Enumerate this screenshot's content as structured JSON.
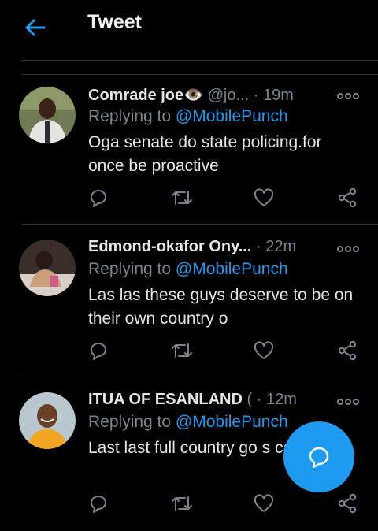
{
  "header": {
    "title": "Tweet",
    "back_icon": "arrow-left-icon"
  },
  "tweets": [
    {
      "name": "Comrade joe👁️",
      "handle": "@jo...",
      "dot": "·",
      "time": "19m",
      "replying_prefix": "Replying to",
      "replying_to": "@MobilePunch",
      "text": "Oga senate do state policing.for once be proactive"
    },
    {
      "name": "Edmond-okafor Ony...",
      "handle": "",
      "dot": "·",
      "time": "22m",
      "replying_prefix": "Replying to",
      "replying_to": "@MobilePunch",
      "text": "Las las these guys deserve to be on their own country o"
    },
    {
      "name": "ITUA OF ESANLAND",
      "handle": "(",
      "dot": "·",
      "time": "12m",
      "replying_prefix": "Replying to",
      "replying_to": "@MobilePunch",
      "text": "Last last full country go s carry gun"
    }
  ],
  "colors": {
    "accent": "#1d9bf0",
    "muted": "#7a8590",
    "background": "#000000"
  },
  "fab": {
    "icon": "compose-reply-icon"
  }
}
